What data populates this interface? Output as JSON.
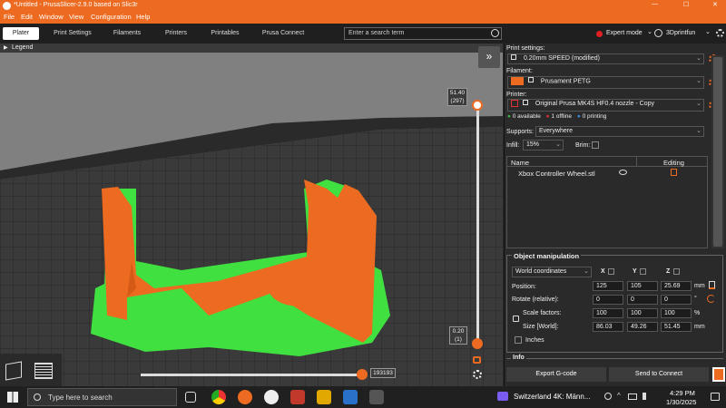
{
  "window": {
    "title": "*Untitled - PrusaSlicer-2.9.0 based on Slic3r",
    "controls": [
      "—",
      "☐",
      "✕"
    ]
  },
  "menu": [
    "File",
    "Edit",
    "Window",
    "View",
    "Configuration",
    "Help"
  ],
  "tabs": [
    "Plater",
    "Print Settings",
    "Filaments",
    "Printers",
    "Printables",
    "Prusa Connect"
  ],
  "search": {
    "placeholder": "Enter a search term"
  },
  "mode": {
    "label": "Expert mode",
    "chev": "⌄"
  },
  "account": {
    "label": "3Dprintfun",
    "chev": "⌄"
  },
  "viewport": {
    "legend": "Legend",
    "legend_arrow": "▶",
    "collapse": "»",
    "top_value": "51.40",
    "top_layer": "(297)",
    "bottom_value": "0.20",
    "bottom_layer": "(1)",
    "hslider_value": "193193"
  },
  "panel": {
    "print_settings_label": "Print settings:",
    "print_settings_value": "0.20mm SPEED (modified)",
    "filament_label": "Filament:",
    "filament_value": "Prusament PETG",
    "filament_color": "#ed6b21",
    "printer_label": "Printer:",
    "printer_value": "Original Prusa MK4S HF0.4 nozzle - Copy",
    "status": [
      {
        "text": "0 available",
        "color": "#3fb53f"
      },
      {
        "text": "1 offline",
        "color": "#e03030"
      },
      {
        "text": "0 printing",
        "color": "#3b8fe0"
      }
    ],
    "supports_label": "Supports:",
    "supports_value": "Everywhere",
    "infill_label": "Infill:",
    "infill_value": "15%",
    "brim_label": "Brim:",
    "table_col_name": "Name",
    "table_col_editing": "Editing",
    "object_name": "Xbox Controller Wheel.stl",
    "om_title": "Object manipulation",
    "coord_value": "World coordinates",
    "axis": [
      "X",
      "Y",
      "Z"
    ],
    "position_label": "Position:",
    "position": [
      "125",
      "105",
      "25.69"
    ],
    "position_unit": "mm",
    "rotate_label": "Rotate (relative):",
    "rotate": [
      "0",
      "0",
      "0"
    ],
    "rotate_unit": "°",
    "scale_label": "Scale factors:",
    "scale": [
      "100",
      "100",
      "100"
    ],
    "scale_unit": "%",
    "size_label": "Size [World]:",
    "size": [
      "86.03",
      "49.26",
      "51.45"
    ],
    "size_unit": "mm",
    "inches_label": "Inches",
    "info_label": "Info",
    "export_label": "Export G-code",
    "send_label": "Send to Connect"
  },
  "taskbar": {
    "search_placeholder": "Type here to search",
    "media_title": "Switzerland 4K: Männ...",
    "time": "4:29 PM",
    "date": "1/30/2025"
  }
}
